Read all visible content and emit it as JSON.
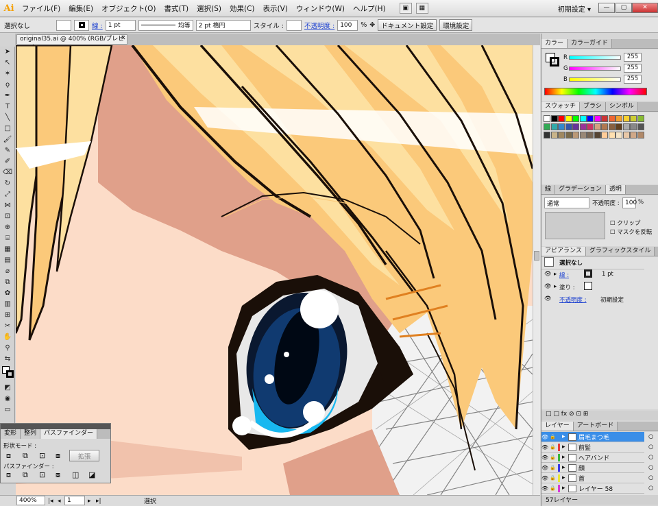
{
  "app": {
    "logo": "Ai",
    "workspace": "初期設定 ▾"
  },
  "menu": [
    "ファイル(F)",
    "編集(E)",
    "オブジェクト(O)",
    "書式(T)",
    "選択(S)",
    "効果(C)",
    "表示(V)",
    "ウィンドウ(W)",
    "ヘルプ(H)"
  ],
  "control": {
    "selection": "選択なし",
    "stroke_link": "線 :",
    "stroke_weight": "1 pt",
    "stroke_profile": "均等",
    "brush": "2 pt 楕円",
    "style_label": "スタイル :",
    "opacity_link": "不透明度 :",
    "opacity": "100",
    "percent": "%",
    "doc_settings": "ドキュメント設定",
    "prefs": "環境設定"
  },
  "document": {
    "tab": "original35.ai @ 400% (RGB/プレビュー)",
    "zoom": "400%",
    "page": "1",
    "status": "選択"
  },
  "color_panel": {
    "tabs": [
      "カラー",
      "カラーガイド"
    ],
    "r_label": "R",
    "g_label": "G",
    "b_label": "B",
    "r": "255",
    "g": "255",
    "b": "255"
  },
  "swatch_panel": {
    "tabs": [
      "スウォッチ",
      "ブラシ",
      "シンボル"
    ],
    "colors": [
      "#ffffff",
      "#000000",
      "#ff0000",
      "#ffff00",
      "#00ff00",
      "#00ffff",
      "#0000ff",
      "#ff00ff",
      "#cc3333",
      "#ee6633",
      "#f0a030",
      "#f8d030",
      "#cccc33",
      "#88bb33",
      "#33aa55",
      "#33aaaa",
      "#3388cc",
      "#3355aa",
      "#663399",
      "#993399",
      "#cc3366",
      "#d4a080",
      "#b07850",
      "#886040",
      "#604020",
      "#aaaaaa",
      "#888888",
      "#555555",
      "#333333",
      "#c9b48a",
      "#a08860",
      "#7a6a4a",
      "#bb9977",
      "#998877",
      "#776655",
      "#554433",
      "#ffcc99",
      "#ffe0b0",
      "#f4e4c8",
      "#e8c8a8",
      "#d0a888",
      "#b08868"
    ]
  },
  "transparency_panel": {
    "tabs": [
      "線",
      "グラデーション",
      "透明"
    ],
    "blend": "通常",
    "opacity_label": "不透明度 :",
    "opacity": "100",
    "percent": "%",
    "clip": "クリップ",
    "invert_mask": "マスクを反転"
  },
  "appearance_panel": {
    "tabs": [
      "アピアランス",
      "グラフィックスタイル"
    ],
    "title": "選択なし",
    "stroke": "線 :",
    "stroke_value": "1 pt",
    "fill": "塗り :",
    "opacity": "不透明度 :",
    "opacity_value": "初期設定"
  },
  "layers_panel": {
    "tabs": [
      "レイヤー",
      "アートボード"
    ],
    "layers": [
      {
        "name": "眉毛まつ毛",
        "color": "#3a8ee8"
      },
      {
        "name": "前髪",
        "color": "#e83a3a"
      },
      {
        "name": "ヘアバンド",
        "color": "#3ab83a"
      },
      {
        "name": "顔",
        "color": "#3a3ae8"
      },
      {
        "name": "首",
        "color": "#e8e83a"
      },
      {
        "name": "レイヤー 58",
        "color": "#d63ad6"
      }
    ],
    "count": "57レイヤー"
  },
  "pathfinder": {
    "tabs": [
      "変形",
      "整列",
      "パスファインダー"
    ],
    "shape_modes": "形状モード :",
    "expand": "拡張",
    "pathfinders": "パスファインダー :"
  }
}
